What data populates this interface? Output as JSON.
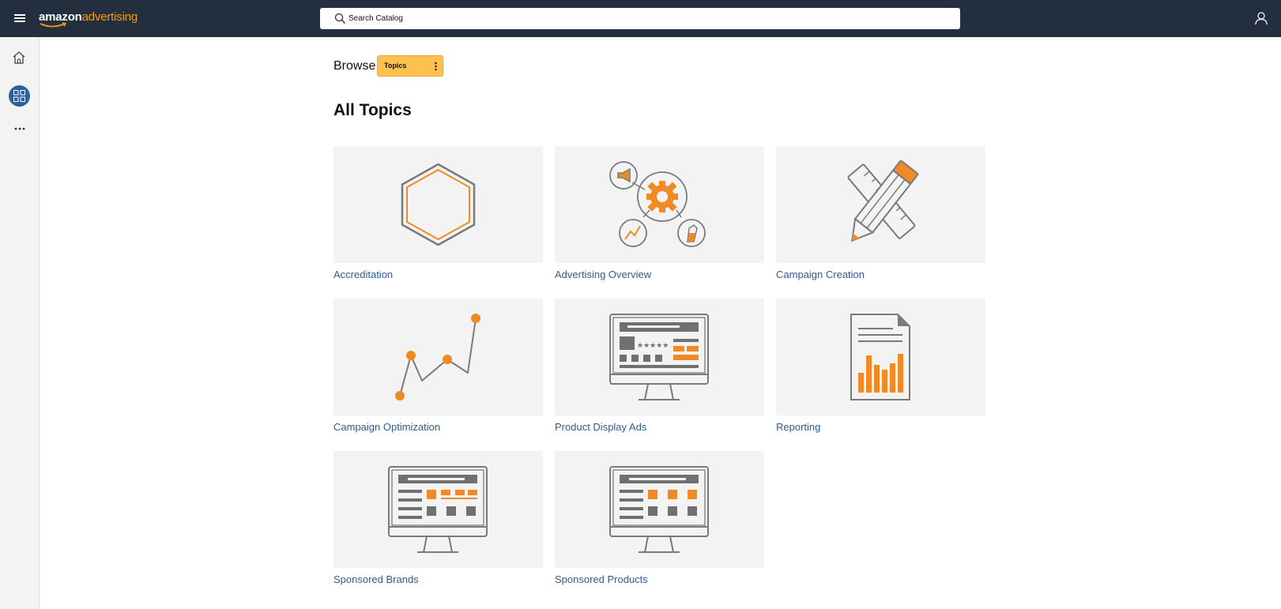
{
  "app": {
    "logo_main": "amazon",
    "logo_accent": "advertising",
    "brand_colors": {
      "navy": "#232f3e",
      "orange": "#ff9900",
      "accent_orange": "#f08a24",
      "link_blue": "#2f5d92",
      "button_yellow": "#fec150"
    }
  },
  "search": {
    "placeholder": "Search Catalog"
  },
  "icons": {
    "menu": "hamburger-menu-icon",
    "search": "search-icon",
    "user": "user-icon",
    "home": "home-icon",
    "catalog": "grid-icon",
    "more": "more-icon"
  },
  "browse": {
    "label": "Browse",
    "button_label": "Topics"
  },
  "page": {
    "title": "All Topics"
  },
  "topics": [
    {
      "label": "Accreditation",
      "icon": "hexagon-icon"
    },
    {
      "label": "Advertising Overview",
      "icon": "gear-network-icon"
    },
    {
      "label": "Campaign Creation",
      "icon": "pencil-ruler-icon"
    },
    {
      "label": "Campaign Optimization",
      "icon": "line-graph-icon"
    },
    {
      "label": "Product Display Ads",
      "icon": "monitor-display-ads-icon"
    },
    {
      "label": "Reporting",
      "icon": "report-document-icon"
    },
    {
      "label": "Sponsored Brands",
      "icon": "monitor-brands-icon"
    },
    {
      "label": "Sponsored Products",
      "icon": "monitor-products-icon"
    }
  ]
}
